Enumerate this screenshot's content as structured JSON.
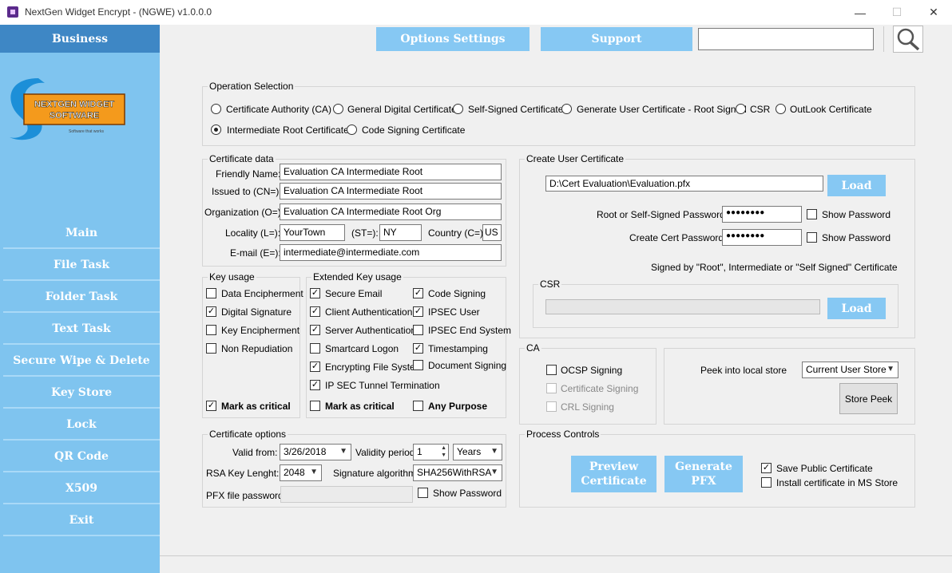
{
  "window": {
    "title": "NextGen Widget Encrypt - (NGWE) v1.0.0.0",
    "minimize": "—",
    "maximize": "☐",
    "close": "✕"
  },
  "sidebar": {
    "header": "Business",
    "logo_line1": "NEXTGEN WIDGET",
    "logo_line2": "SOFTWARE",
    "logo_tagline": "Software that works",
    "items": [
      {
        "label": "Main"
      },
      {
        "label": "File Task"
      },
      {
        "label": "Folder Task"
      },
      {
        "label": "Text Task"
      },
      {
        "label": "Secure Wipe & Delete"
      },
      {
        "label": "Key Store"
      },
      {
        "label": "Lock"
      },
      {
        "label": "QR Code"
      },
      {
        "label": "X509"
      },
      {
        "label": "Exit"
      }
    ]
  },
  "toolbar": {
    "options_settings": "Options Settings",
    "support": "Support",
    "search_value": ""
  },
  "operation_selection": {
    "title": "Operation Selection",
    "options": [
      {
        "label": "Certificate Authority  (CA)",
        "selected": false
      },
      {
        "label": "General Digital Certificate",
        "selected": false
      },
      {
        "label": "Self-Signed Certificate",
        "selected": false
      },
      {
        "label": "Generate User Certificate - Root Signed",
        "selected": false
      },
      {
        "label": "CSR",
        "selected": false
      },
      {
        "label": "OutLook Certificate",
        "selected": false
      },
      {
        "label": "Intermediate Root Certificate",
        "selected": true
      },
      {
        "label": "Code Signing Certificate",
        "selected": false
      }
    ]
  },
  "certificate_data": {
    "title": "Certificate data",
    "friendly_name_label": "Friendly Name:",
    "friendly_name": "Evaluation CA Intermediate Root",
    "issued_to_label": "Issued to (CN=):",
    "issued_to": "Evaluation CA Intermediate Root",
    "organization_label": "Organization (O=):",
    "organization": "Evaluation CA Intermediate Root Org",
    "locality_label": "Locality (L=):",
    "locality": "YourTown",
    "state_label": "(ST=):",
    "state": "NY",
    "country_label": "Country (C=):",
    "country": "US",
    "email_label": "E-mail (E=):",
    "email": "intermediate@intermediate.com"
  },
  "key_usage": {
    "title": "Key usage",
    "items": [
      {
        "label": "Data Encipherment",
        "checked": false
      },
      {
        "label": "Digital Signature",
        "checked": true
      },
      {
        "label": "Key Encipherment",
        "checked": false
      },
      {
        "label": "Non Repudiation",
        "checked": false
      }
    ],
    "critical": {
      "label": "Mark as critical",
      "checked": true
    }
  },
  "extended_key_usage": {
    "title": "Extended Key usage",
    "col1": [
      {
        "label": "Secure Email",
        "checked": true
      },
      {
        "label": "Client Authentication",
        "checked": true
      },
      {
        "label": "Server Authentication",
        "checked": true
      },
      {
        "label": "Smartcard Logon",
        "checked": false
      },
      {
        "label": "Encrypting File System",
        "checked": true
      },
      {
        "label": "IP SEC Tunnel Termination",
        "checked": true
      }
    ],
    "col2": [
      {
        "label": "Code Signing",
        "checked": true
      },
      {
        "label": "IPSEC User",
        "checked": true
      },
      {
        "label": "IPSEC End System",
        "checked": false
      },
      {
        "label": "Timestamping",
        "checked": true
      },
      {
        "label": "Document Signing",
        "checked": false
      }
    ],
    "critical": {
      "label": "Mark as critical",
      "checked": false
    },
    "any_purpose": {
      "label": "Any Purpose",
      "checked": false
    }
  },
  "certificate_options": {
    "title": "Certificate options",
    "valid_from_label": "Valid from:",
    "valid_from": "3/26/2018",
    "validity_label": "Validity period:",
    "validity_value": "1",
    "validity_unit": "Years",
    "rsa_label": "RSA Key Lenght:",
    "rsa_value": "2048",
    "sig_label": "Signature algorithm:",
    "sig_value": "SHA256WithRSA",
    "pfx_label": "PFX file password:",
    "pfx_value": "",
    "show_password": "Show Password"
  },
  "create_user_certificate": {
    "title": "Create User Certificate",
    "path": "D:\\Cert Evaluation\\Evaluation.pfx",
    "load": "Load",
    "root_pw_label": "Root or Self-Signed  Password:",
    "root_pw": "●●●●●●●●",
    "create_pw_label": "Create Cert Password:",
    "create_pw": "●●●●●●●●",
    "show_password": "Show Password",
    "signed_note": "Signed by \"Root\", Intermediate or \"Self Signed\" Certificate",
    "csr_title": "CSR",
    "csr_value": "",
    "csr_load": "Load"
  },
  "ca": {
    "title": "CA",
    "items": [
      {
        "label": "OCSP Signing",
        "checked": false,
        "enabled": true
      },
      {
        "label": "Certificate Signing",
        "checked": false,
        "enabled": false
      },
      {
        "label": "CRL Signing",
        "checked": false,
        "enabled": false
      }
    ]
  },
  "peek": {
    "label": "Peek into local store",
    "store": "Current User Store",
    "button": "Store Peek"
  },
  "process_controls": {
    "title": "Process Controls",
    "preview": "Preview Certificate",
    "generate": "Generate PFX",
    "save_public": {
      "label": "Save Public Certificate",
      "checked": true
    },
    "install_ms": {
      "label": "Install certificate in MS Store",
      "checked": false
    }
  }
}
